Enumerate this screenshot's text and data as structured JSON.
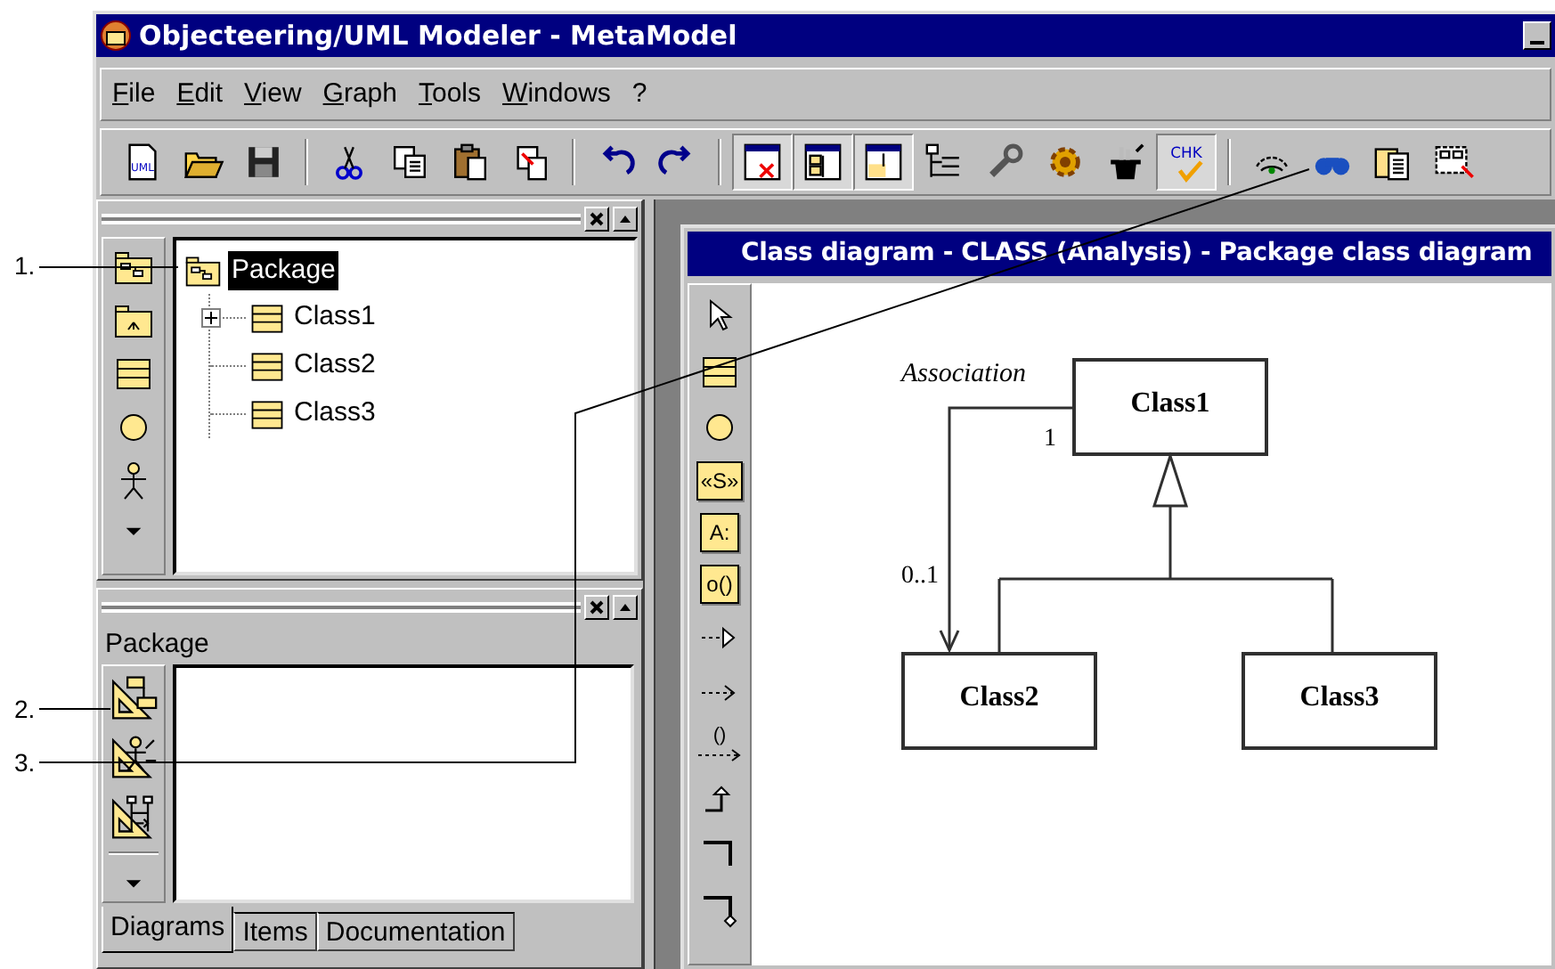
{
  "window": {
    "title": "Objecteering/UML Modeler - MetaModel"
  },
  "menu": [
    "File",
    "Edit",
    "View",
    "Graph",
    "Tools",
    "Windows",
    "?"
  ],
  "toolbar": [
    [
      {
        "kind": "new",
        "glyph": "UML",
        "pressed": false
      },
      {
        "kind": "open",
        "pressed": false
      },
      {
        "kind": "save",
        "pressed": false
      }
    ],
    [
      {
        "kind": "cut",
        "pressed": false
      },
      {
        "kind": "copy",
        "pressed": false
      },
      {
        "kind": "paste",
        "pressed": false
      },
      {
        "kind": "paste-special",
        "pressed": false
      }
    ],
    [
      {
        "kind": "undo",
        "pressed": false
      },
      {
        "kind": "redo",
        "pressed": false
      }
    ],
    [
      {
        "kind": "window-delete",
        "pressed": true
      },
      {
        "kind": "window-list",
        "pressed": true
      },
      {
        "kind": "window-panel",
        "pressed": true
      },
      {
        "kind": "tree",
        "pressed": false
      },
      {
        "kind": "wrench",
        "pressed": false
      },
      {
        "kind": "gear",
        "pressed": false
      },
      {
        "kind": "hat",
        "pressed": false
      },
      {
        "kind": "check",
        "glyph": "CHK",
        "pressed": true
      }
    ],
    [
      {
        "kind": "eye",
        "pressed": false
      },
      {
        "kind": "binoculars",
        "pressed": false
      },
      {
        "kind": "clipdoc",
        "pressed": false
      },
      {
        "kind": "pkgarrow",
        "pressed": false
      }
    ]
  ],
  "explorer": {
    "tree": {
      "label": "Package",
      "selected": true,
      "children": [
        {
          "label": "Class1",
          "selected": false,
          "expanded": false
        },
        {
          "label": "Class2",
          "selected": false
        },
        {
          "label": "Class3",
          "selected": false
        }
      ]
    }
  },
  "properties": {
    "title": "Package",
    "tabs": [
      {
        "label": "Diagrams",
        "selected": true
      },
      {
        "label": "Items",
        "selected": false
      },
      {
        "label": "Documentation",
        "selected": false
      }
    ]
  },
  "diagram": {
    "title": "Class diagram - CLASS  (Analysis) - Package class diagram",
    "tools": [
      {
        "kind": "pointer"
      },
      {
        "kind": "class"
      },
      {
        "kind": "circle"
      },
      {
        "kind": "box",
        "glyph": "«S»"
      },
      {
        "kind": "box",
        "glyph": "A:"
      },
      {
        "kind": "box",
        "glyph": "o()"
      },
      {
        "kind": "dashed-triangle"
      },
      {
        "kind": "dashed-arrow"
      },
      {
        "kind": "call-arrow",
        "glyph": "()"
      },
      {
        "kind": "step"
      },
      {
        "kind": "corner"
      },
      {
        "kind": "corner-diamond"
      }
    ],
    "classes": [
      "Class1",
      "Class2",
      "Class3"
    ],
    "association": {
      "name": "Association",
      "source_multiplicity": "1",
      "target_multiplicity": "0..1"
    }
  },
  "callouts": [
    "1.",
    "2.",
    "3."
  ]
}
